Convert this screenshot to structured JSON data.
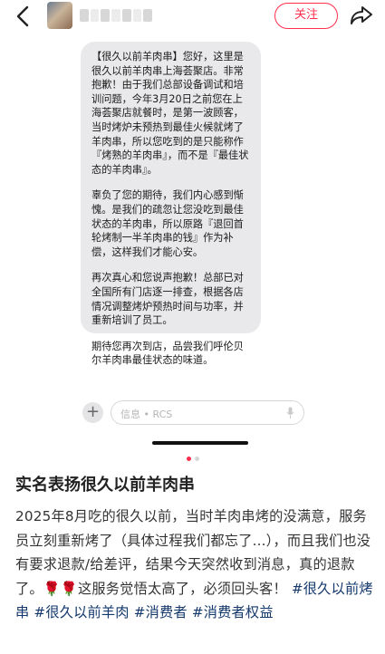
{
  "header": {
    "follow_label": "关注"
  },
  "screenshot": {
    "message_paragraphs": [
      "【很久以前羊肉串】您好，这里是很久以前羊肉串上海荟聚店。非常抱歉！由于我们总部设备调试和培训问题，今年3月20日之前您在上海荟聚店就餐时，是第一波顾客，当时烤炉未预热到最佳火候就烤了羊肉串，所以您吃到的是只能称作『烤熟的羊肉串』，而不是『最佳状态的羊肉串』。",
      "辜负了您的期待，我们内心感到惭愧。是我们的疏忽让您没吃到最佳状态的羊肉串，所以原路『退回首轮烤制一半羊肉串的钱』作为补偿，这样我们才能心安。",
      "再次真心和您说声抱歉！总部已对全国所有门店逐一排查，根据各店情况调整烤炉预热时间与功率，并重新培训了员工。",
      "期待您再次到店，品尝我们呼伦贝尔羊肉串最佳状态的味道。"
    ],
    "input_placeholder": "信息 • RCS",
    "plus_label": "+"
  },
  "post": {
    "title": "实名表扬很久以前羊肉串",
    "body_text": "2025年8月吃的很久以前，当时羊肉串烤的没满意，服务员立刻重新烤了（具体过程我们都忘了...），而且我们也没有要求退款/给差评，结果今天突然收到消息，真的退款了。",
    "emoji": "🌹🌹",
    "body_text_2": "这服务觉悟太高了，必须回头客！",
    "tags": [
      "#很久以前烤串",
      "#很久以前羊肉",
      "#消费者",
      "#消费者权益"
    ]
  },
  "colors": {
    "accent": "#ff2e4d",
    "tag": "#13386c",
    "bubble": "#e9e9eb"
  },
  "pager": {
    "total": 2,
    "active": 1
  }
}
